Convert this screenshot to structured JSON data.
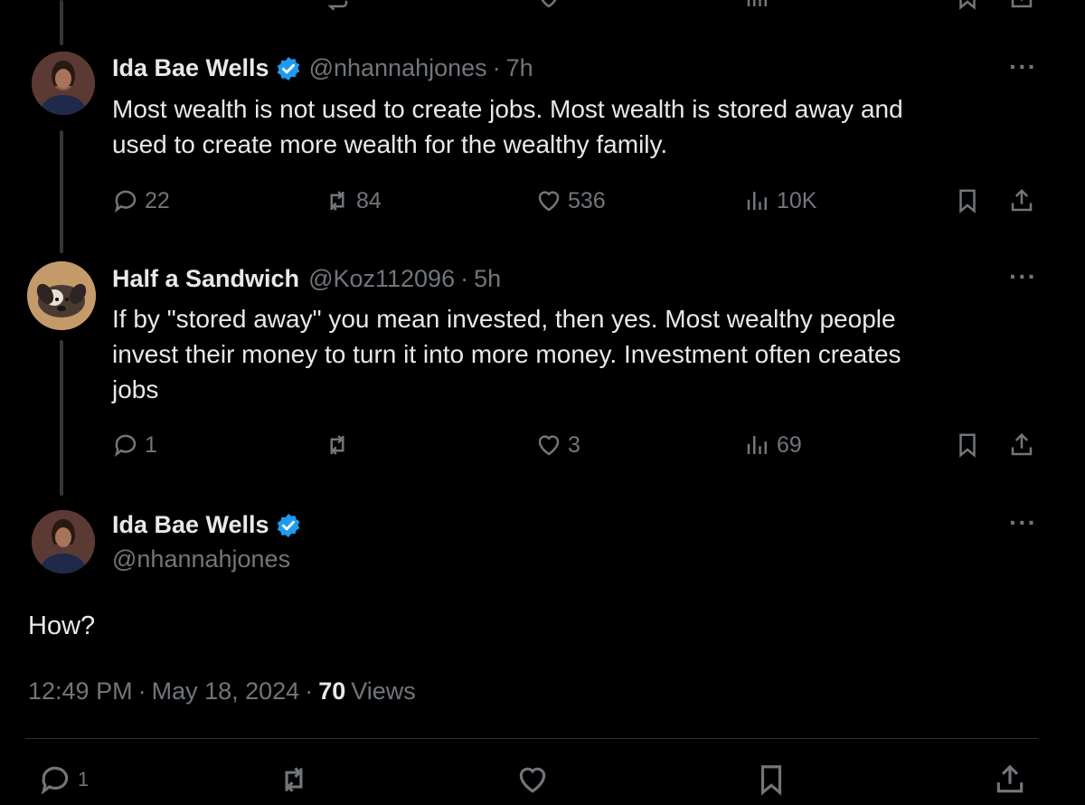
{
  "tweets": [
    {
      "name": "Ida Bae Wells",
      "handle": "@nhannahjones",
      "time": "7h",
      "text_lines": [
        "Most wealth is not used to create jobs. Most wealth is stored away and",
        "used to create more wealth for the wealthy family."
      ],
      "replies": "22",
      "reposts": "84",
      "likes": "536",
      "views": "10K"
    },
    {
      "name": "Half a Sandwich",
      "handle": "@Koz112096",
      "time": "5h",
      "text_lines": [
        "If by \"stored away\" you mean invested, then yes. Most wealthy people",
        "invest their money to turn it into more money. Investment often creates",
        "jobs"
      ],
      "replies": "1",
      "reposts": "",
      "likes": "3",
      "views": "69"
    }
  ],
  "main": {
    "name": "Ida Bae Wells",
    "handle": "@nhannahjones",
    "text": "How?",
    "time": "12:49 PM",
    "date": "May 18, 2024",
    "views_count": "70",
    "views_label": "Views",
    "replies": "1"
  },
  "separator": "·",
  "colors": {
    "verified": "#1d9bf0",
    "muted": "#71767b",
    "text": "#e7e9ea",
    "background": "#000000"
  },
  "icons": [
    "reply-icon",
    "repost-icon",
    "like-icon",
    "views-icon",
    "bookmark-icon",
    "share-icon",
    "more-icon",
    "verified-badge-icon"
  ]
}
